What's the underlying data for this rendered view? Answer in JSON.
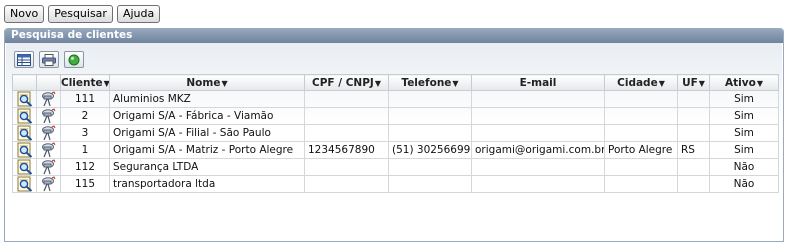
{
  "topbar": {
    "novo_label": "Novo",
    "pesquisar_label": "Pesquisar",
    "ajuda_label": "Ajuda"
  },
  "panel": {
    "title": "Pesquisa de clientes"
  },
  "columns": {
    "cliente": "Cliente",
    "nome": "Nome",
    "cpf": "CPF / CNPJ",
    "telefone": "Telefone",
    "email": "E-mail",
    "cidade": "Cidade",
    "uf": "UF",
    "ativo": "Ativo",
    "sort_arrow": "▼"
  },
  "rows": [
    {
      "cliente": "111",
      "nome": "Aluminios MKZ",
      "cpf": "",
      "telefone": "",
      "email": "",
      "cidade": "",
      "uf": "",
      "ativo": "Sim"
    },
    {
      "cliente": "2",
      "nome": "Origami S/A - Fábrica - Viamão",
      "cpf": "",
      "telefone": "",
      "email": "",
      "cidade": "",
      "uf": "",
      "ativo": "Sim"
    },
    {
      "cliente": "3",
      "nome": "Origami S/A - Filial - São Paulo",
      "cpf": "",
      "telefone": "",
      "email": "",
      "cidade": "",
      "uf": "",
      "ativo": "Sim"
    },
    {
      "cliente": "1",
      "nome": "Origami S/A - Matriz - Porto Alegre",
      "cpf": "1234567890",
      "telefone": "(51) 30256699",
      "email": "origami@origami.com.br",
      "cidade": "Porto Alegre",
      "uf": "RS",
      "ativo": "Sim"
    },
    {
      "cliente": "112",
      "nome": "Segurança LTDA",
      "cpf": "",
      "telefone": "",
      "email": "",
      "cidade": "",
      "uf": "",
      "ativo": "Não"
    },
    {
      "cliente": "115",
      "nome": "transportadora ltda",
      "cpf": "",
      "telefone": "",
      "email": "",
      "cidade": "",
      "uf": "",
      "ativo": "Não"
    }
  ]
}
